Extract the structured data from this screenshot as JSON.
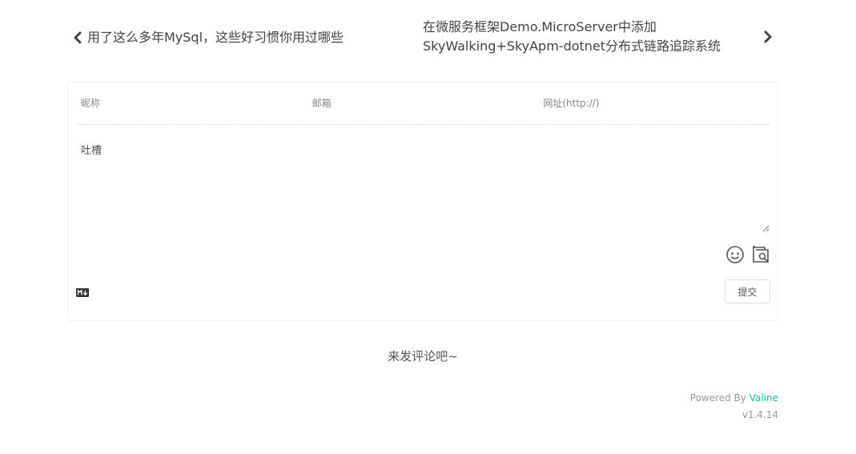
{
  "post_nav": {
    "prev": {
      "title": "用了这么多年MySql，这些好习惯你用过哪些",
      "icon": "chevron-left-icon"
    },
    "next": {
      "title": "在微服务框架Demo.MicroServer中添加SkyWalking+SkyApm-dotnet分布式链路追踪系统",
      "icon": "chevron-right-icon"
    }
  },
  "comment_form": {
    "nick_placeholder": "昵称",
    "mail_placeholder": "邮箱",
    "link_placeholder": "网址(http://)",
    "comment_placeholder": "吐槽",
    "emoji_icon": "emoji-icon",
    "preview_icon": "preview-icon",
    "markdown_icon": "markdown-icon",
    "submit_label": "提交"
  },
  "empty_message": "来发评论吧~",
  "footer": {
    "powered_by": "Powered By",
    "brand": "Valine",
    "version": "v1.4.14",
    "brand_color": "#1abc9c"
  }
}
